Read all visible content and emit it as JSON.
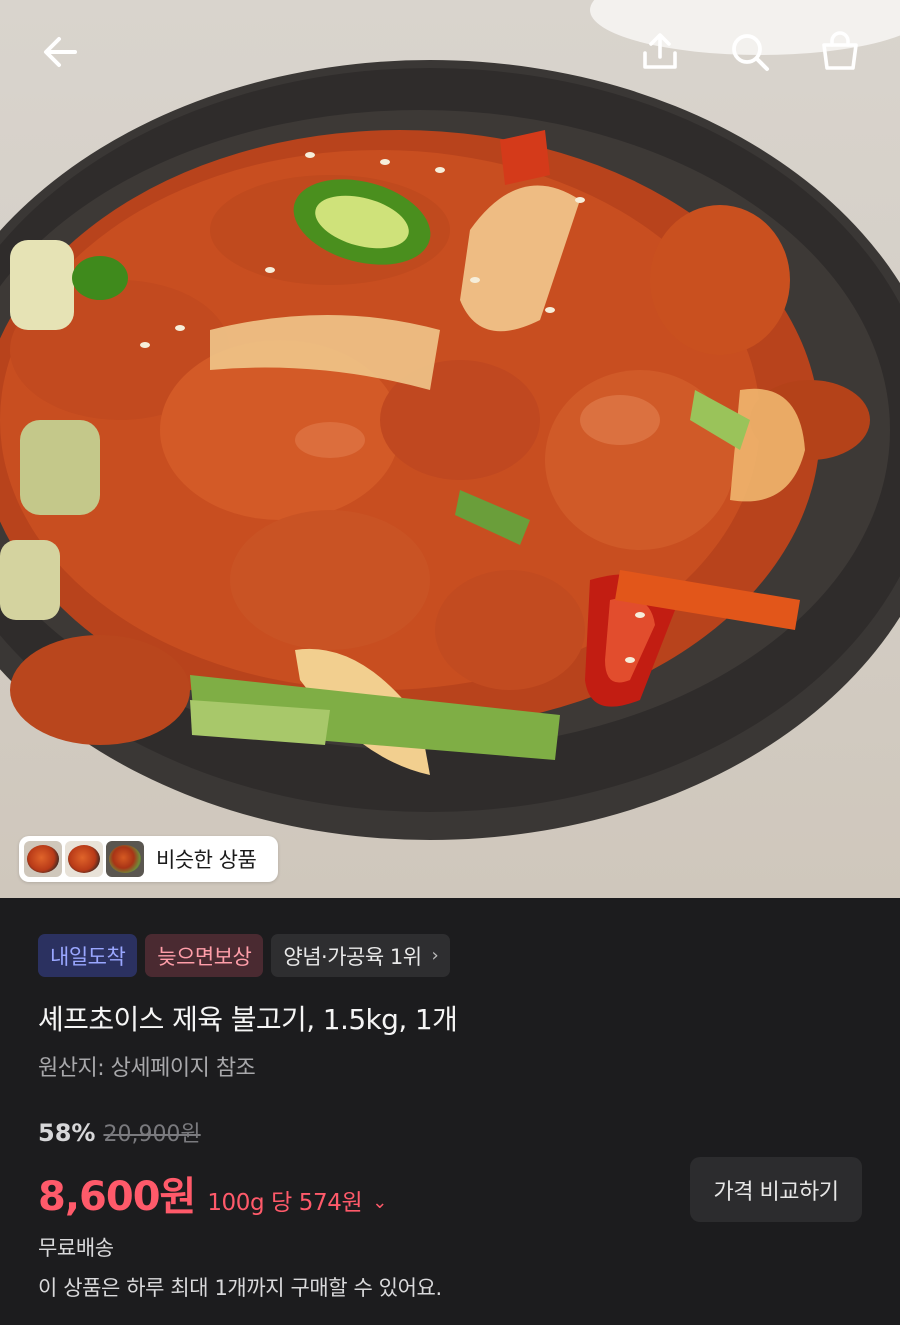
{
  "header": {
    "back_icon": "arrow-left-icon",
    "share_icon": "share-upload-icon",
    "search_icon": "search-icon",
    "cart_icon": "shopping-bag-icon"
  },
  "hero": {
    "image_subject": "spicy pork bulgogi in dark stone dish",
    "similar_label": "비슷한 상품",
    "similar_thumbnails": 3
  },
  "product": {
    "badges": {
      "arrival": "내일도착",
      "late_compensation": "늦으면보상",
      "ranking": "양념·가공육 1위",
      "ranking_chevron": "›"
    },
    "title": "셰프초이스 제육 불고기, 1.5kg, 1개",
    "origin": "원산지: 상세페이지 참조",
    "discount_rate": "58%",
    "original_price": "20,900원",
    "price": "8,600원",
    "unit_price": "100g 당 574원",
    "unit_price_chevron": "⌄",
    "compare_button": "가격 비교하기",
    "shipping": "무료배송",
    "purchase_limit": "이 상품은 하루 최대 1개까지 구매할 수 있어요."
  },
  "colors": {
    "price_red": "#ff5a6a",
    "panel_bg": "#1c1c1e",
    "arrival_badge_bg": "#2b3160",
    "late_badge_bg": "#4a2a31"
  }
}
